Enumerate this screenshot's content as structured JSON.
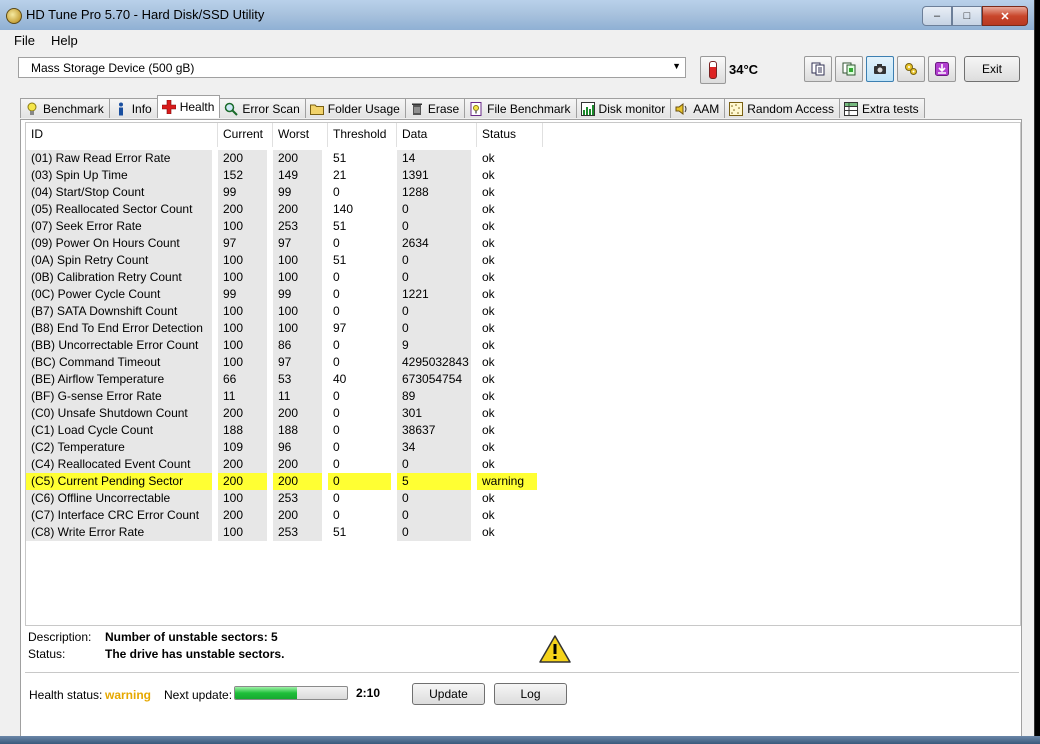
{
  "window": {
    "title": "HD Tune Pro 5.70 - Hard Disk/SSD Utility",
    "controls": {
      "minimize": "–",
      "maximize": "□",
      "close": "✕"
    }
  },
  "menu": {
    "items": [
      "File",
      "Help"
    ]
  },
  "toolbar": {
    "device": "Mass Storage Device (500 gB)",
    "temperature": "34°C",
    "exit_label": "Exit",
    "icons": [
      "copy-text-icon",
      "copy-screenshot-icon",
      "camera-icon",
      "options-icon",
      "download-icon"
    ]
  },
  "tabs": [
    {
      "label": "Benchmark",
      "icon": "lightbulb-icon"
    },
    {
      "label": "Info",
      "icon": "info-icon"
    },
    {
      "label": "Health",
      "icon": "health-cross-icon",
      "active": true
    },
    {
      "label": "Error Scan",
      "icon": "magnifier-icon"
    },
    {
      "label": "Folder Usage",
      "icon": "folder-icon"
    },
    {
      "label": "Erase",
      "icon": "trash-icon"
    },
    {
      "label": "File Benchmark",
      "icon": "file-benchmark-icon"
    },
    {
      "label": "Disk monitor",
      "icon": "disk-monitor-icon"
    },
    {
      "label": "AAM",
      "icon": "speaker-icon"
    },
    {
      "label": "Random Access",
      "icon": "random-access-icon"
    },
    {
      "label": "Extra tests",
      "icon": "extra-tests-icon"
    }
  ],
  "smart": {
    "columns": [
      "ID",
      "Current",
      "Worst",
      "Threshold",
      "Data",
      "Status"
    ],
    "rows": [
      [
        "(01) Raw Read Error Rate",
        "200",
        "200",
        "51",
        "14",
        "ok"
      ],
      [
        "(03) Spin Up Time",
        "152",
        "149",
        "21",
        "1391",
        "ok"
      ],
      [
        "(04) Start/Stop Count",
        "99",
        "99",
        "0",
        "1288",
        "ok"
      ],
      [
        "(05) Reallocated Sector Count",
        "200",
        "200",
        "140",
        "0",
        "ok"
      ],
      [
        "(07) Seek Error Rate",
        "100",
        "253",
        "51",
        "0",
        "ok"
      ],
      [
        "(09) Power On Hours Count",
        "97",
        "97",
        "0",
        "2634",
        "ok"
      ],
      [
        "(0A) Spin Retry Count",
        "100",
        "100",
        "51",
        "0",
        "ok"
      ],
      [
        "(0B) Calibration Retry Count",
        "100",
        "100",
        "0",
        "0",
        "ok"
      ],
      [
        "(0C) Power Cycle Count",
        "99",
        "99",
        "0",
        "1221",
        "ok"
      ],
      [
        "(B7) SATA Downshift Count",
        "100",
        "100",
        "0",
        "0",
        "ok"
      ],
      [
        "(B8) End To End Error Detection",
        "100",
        "100",
        "97",
        "0",
        "ok"
      ],
      [
        "(BB) Uncorrectable Error Count",
        "100",
        "86",
        "0",
        "9",
        "ok"
      ],
      [
        "(BC) Command Timeout",
        "100",
        "97",
        "0",
        "4295032843",
        "ok"
      ],
      [
        "(BE) Airflow Temperature",
        "66",
        "53",
        "40",
        "673054754",
        "ok"
      ],
      [
        "(BF) G-sense Error Rate",
        "11",
        "11",
        "0",
        "89",
        "ok"
      ],
      [
        "(C0) Unsafe Shutdown Count",
        "200",
        "200",
        "0",
        "301",
        "ok"
      ],
      [
        "(C1) Load Cycle Count",
        "188",
        "188",
        "0",
        "38637",
        "ok"
      ],
      [
        "(C2) Temperature",
        "109",
        "96",
        "0",
        "34",
        "ok"
      ],
      [
        "(C4) Reallocated Event Count",
        "200",
        "200",
        "0",
        "0",
        "ok"
      ],
      [
        "(C5) Current Pending Sector",
        "200",
        "200",
        "0",
        "5",
        "warning"
      ],
      [
        "(C6) Offline Uncorrectable",
        "100",
        "253",
        "0",
        "0",
        "ok"
      ],
      [
        "(C7) Interface CRC Error Count",
        "200",
        "200",
        "0",
        "0",
        "ok"
      ],
      [
        "(C8) Write Error Rate",
        "100",
        "253",
        "51",
        "0",
        "ok"
      ]
    ],
    "highlight_row": 19,
    "highlight_color": "#ffff33"
  },
  "details": {
    "description_label": "Description:",
    "description": "Number of unstable sectors: 5",
    "status_label": "Status:",
    "status": "The drive has unstable sectors."
  },
  "footer": {
    "health_status_label": "Health status:",
    "health_status": "warning",
    "health_status_color": "#e6a800",
    "next_update_label": "Next update:",
    "next_update_progress": 0.55,
    "countdown": "2:10",
    "update_button": "Update",
    "log_button": "Log"
  }
}
